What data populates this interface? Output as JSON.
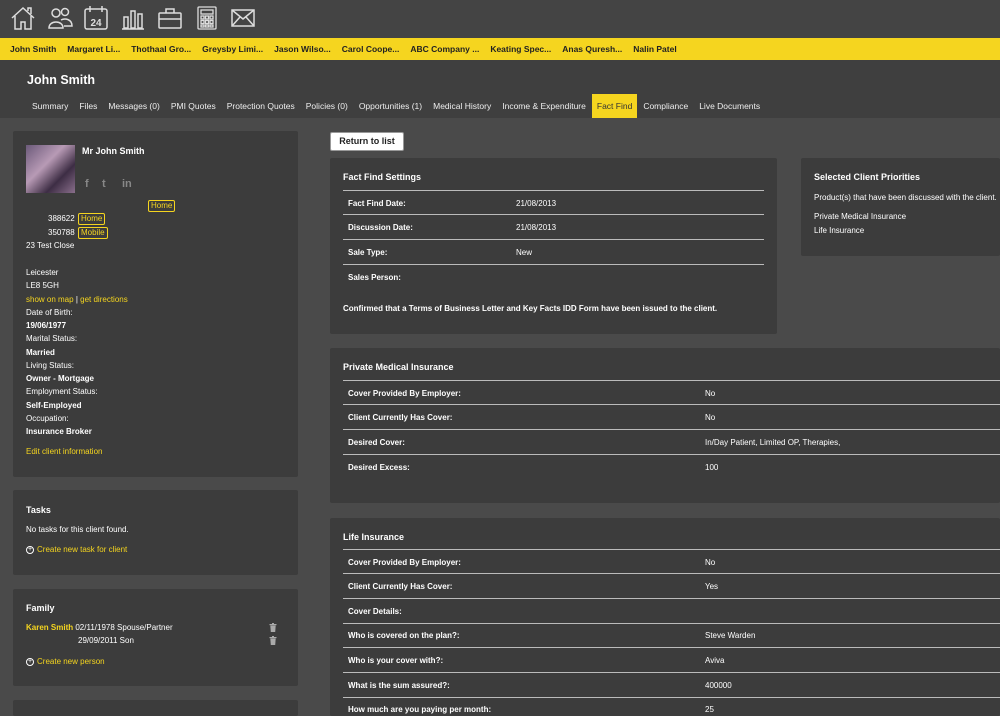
{
  "toolbar": {
    "icons": [
      "home-icon",
      "people-icon",
      "calendar-icon",
      "bar-chart-icon",
      "briefcase-icon",
      "calculator-icon",
      "mail-icon"
    ],
    "calendar_day": "24"
  },
  "client_tabs": [
    "John Smith",
    "Margaret Li...",
    "Thothaal Gro...",
    "Greysby Limi...",
    "Jason Wilso...",
    "Carol Coope...",
    "ABC Company ...",
    "Keating Spec...",
    "Anas Quresh...",
    "Nalin Patel"
  ],
  "header": {
    "client_name": "John Smith",
    "tabs": [
      "Summary",
      "Files",
      "Messages (0)",
      "PMI Quotes",
      "Protection Quotes",
      "Policies (0)",
      "Opportunities (1)",
      "Medical History",
      "Income & Expenditure",
      "Fact Find",
      "Compliance",
      "Live Documents"
    ],
    "active_tab": "Fact Find"
  },
  "profile": {
    "name": "Mr John Smith",
    "social": [
      "f",
      "t",
      "in"
    ],
    "email_badge": "Home",
    "phone1": "388622",
    "phone1_type": "Home",
    "phone2": "350788",
    "phone2_type": "Mobile",
    "address1": "23 Test Close",
    "city": "Leicester",
    "postcode": "LE8 5GH",
    "show_on_map": "show on map",
    "sep": "|",
    "get_directions": "get directions",
    "dob_label": "Date of Birth:",
    "dob": "19/06/1977",
    "marital_label": "Marital Status:",
    "marital": "Married",
    "living_label": "Living Status:",
    "living": "Owner - Mortgage",
    "employment_label": "Employment Status:",
    "employment": "Self-Employed",
    "occupation_label": "Occupation:",
    "occupation": "Insurance Broker",
    "edit_link": "Edit client information"
  },
  "tasks": {
    "title": "Tasks",
    "empty": "No tasks for this client found.",
    "create": "Create new task for client"
  },
  "family": {
    "title": "Family",
    "members": [
      {
        "name": "Karen Smith",
        "details": "02/11/1978 Spouse/Partner"
      },
      {
        "name": "",
        "details": "29/09/2011 Son"
      }
    ],
    "create": "Create new person"
  },
  "return_button": "Return to list",
  "fact_find_settings": {
    "title": "Fact Find Settings",
    "rows": [
      {
        "label": "Fact Find Date:",
        "value": "21/08/2013"
      },
      {
        "label": "Discussion Date:",
        "value": "21/08/2013"
      },
      {
        "label": "Sale Type:",
        "value": "New"
      },
      {
        "label": "Sales Person:",
        "value": ""
      }
    ],
    "note": "Confirmed that a Terms of Business Letter and Key Facts IDD Form have been issued to the client."
  },
  "priorities": {
    "title": "Selected Client Priorities",
    "subtitle": "Product(s) that have been discussed with the client.",
    "items": [
      "Private Medical Insurance",
      "Life Insurance"
    ]
  },
  "pmi": {
    "title": "Private Medical Insurance",
    "rows": [
      {
        "label": "Cover Provided By Employer:",
        "value": "No"
      },
      {
        "label": "Client Currently Has Cover:",
        "value": "No"
      },
      {
        "label": "Desired Cover:",
        "value": "In/Day Patient, Limited OP, Therapies,"
      },
      {
        "label": "Desired Excess:",
        "value": "100"
      }
    ]
  },
  "life": {
    "title": "Life Insurance",
    "rows": [
      {
        "label": "Cover Provided By Employer:",
        "value": "No"
      },
      {
        "label": "Client Currently Has Cover:",
        "value": "Yes"
      },
      {
        "label": "Cover Details:",
        "value": ""
      },
      {
        "label": "Who is covered on the plan?:",
        "value": "Steve Warden"
      },
      {
        "label": "Who is your cover with?:",
        "value": "Aviva"
      },
      {
        "label": "What is the sum assured?:",
        "value": "400000"
      },
      {
        "label": "How much are you paying per month:",
        "value": "25"
      }
    ]
  },
  "colors": {
    "accent": "#f5d51f",
    "panel": "#3c3c3c",
    "background": "#4a4a4a"
  }
}
